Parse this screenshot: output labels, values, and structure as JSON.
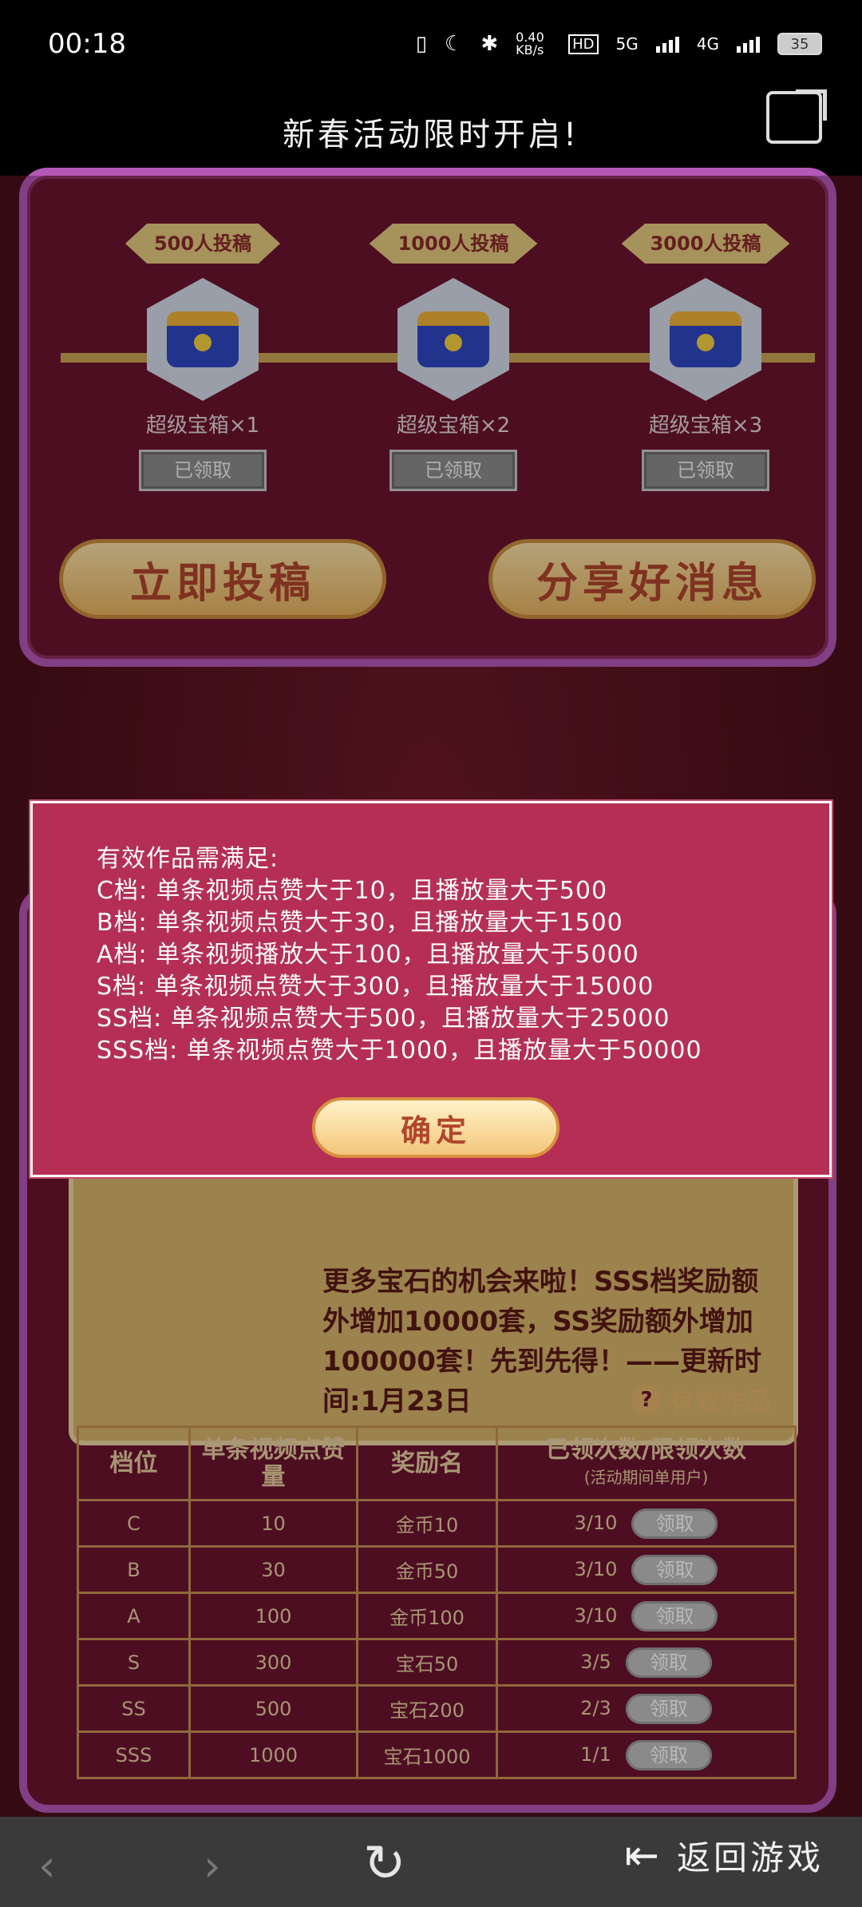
{
  "status_bar": {
    "time": "00:18",
    "net_speed": "0.40 KB/s",
    "hd": "HD",
    "net1": "5G",
    "net2": "4G",
    "battery": "35"
  },
  "header": {
    "title": "新春活动限时开启!"
  },
  "rewards": {
    "milestones": [
      {
        "tag": "500人投稿",
        "label": "超级宝箱×1",
        "button": "已领取"
      },
      {
        "tag": "1000人投稿",
        "label": "超级宝箱×2",
        "button": "已领取"
      },
      {
        "tag": "3000人投稿",
        "label": "超级宝箱×3",
        "button": "已领取"
      }
    ],
    "submit_button": "立即投稿",
    "share_button": "分享好消息"
  },
  "notice": {
    "text": "更多宝石的机会来啦！SSS档奖励额外增加10000套，SS奖励额外增加100000套！先到先得！——更新时间:1月23日"
  },
  "valid_works_label": "有效作品",
  "table": {
    "headers": [
      "档位",
      "单条视频点赞量",
      "奖励名",
      "已领次数/限领次数"
    ],
    "header_note": "(活动期间单用户)",
    "rows": [
      {
        "tier": "C",
        "likes": "10",
        "reward": "金币10",
        "count": "3/10",
        "action": "领取"
      },
      {
        "tier": "B",
        "likes": "30",
        "reward": "金币50",
        "count": "3/10",
        "action": "领取"
      },
      {
        "tier": "A",
        "likes": "100",
        "reward": "金币100",
        "count": "3/10",
        "action": "领取"
      },
      {
        "tier": "S",
        "likes": "300",
        "reward": "宝石50",
        "count": "3/5",
        "action": "领取"
      },
      {
        "tier": "SS",
        "likes": "500",
        "reward": "宝石200",
        "count": "2/3",
        "action": "领取"
      },
      {
        "tier": "SSS",
        "likes": "1000",
        "reward": "宝石1000",
        "count": "1/1",
        "action": "领取"
      }
    ]
  },
  "modal": {
    "lines": [
      "有效作品需满足:",
      "C档: 单条视频点赞大于10，且播放量大于500",
      "B档: 单条视频点赞大于30，且播放量大于1500",
      "A档: 单条视频播放大于100，且播放量大于5000",
      "S档: 单条视频点赞大于300，且播放量大于15000",
      "SS档: 单条视频点赞大于500，且播放量大于25000",
      "SSS档: 单条视频点赞大于1000，且播放量大于50000"
    ],
    "confirm": "确定"
  },
  "bottom_nav": {
    "return_label": "返回游戏"
  }
}
